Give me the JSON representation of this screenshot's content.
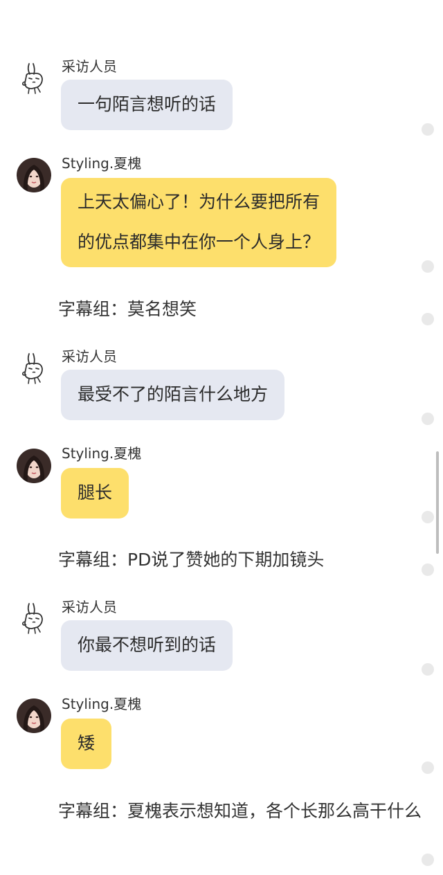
{
  "chat": {
    "messages": [
      {
        "sender": "采访人员",
        "text": "一句陌言想听的话"
      },
      {
        "sender": "Styling.夏槐",
        "lines": [
          "上天太偏心了！为什么要把所有",
          "的优点都集中在你一个人身上？"
        ]
      },
      {
        "caption": "字幕组：莫名想笑"
      },
      {
        "sender": "采访人员",
        "text": "最受不了的陌言什么地方"
      },
      {
        "sender": "Styling.夏槐",
        "text": "腿长"
      },
      {
        "caption": "字幕组：PD说了赞她的下期加镜头"
      },
      {
        "sender": "采访人员",
        "text": "你最不想听到的话"
      },
      {
        "sender": "Styling.夏槐",
        "text": "矮"
      },
      {
        "caption": "字幕组：夏槐表示想知道，各个长那么高干什么"
      }
    ]
  },
  "icons": {
    "interviewer_avatar": "rabbit-doodle-icon",
    "styling_avatar": "profile-photo",
    "read_indicator": "read-dot"
  },
  "colors": {
    "interviewer_bubble": "#e5e8f1",
    "styling_bubble": "#fddf6c",
    "background": "#ffffff"
  }
}
